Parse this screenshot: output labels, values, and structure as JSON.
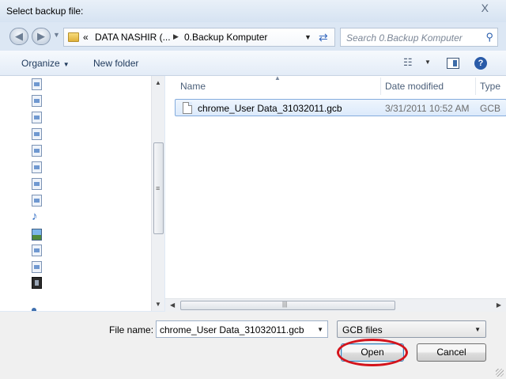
{
  "window": {
    "title": "Select backup file:",
    "close_glyph": "X"
  },
  "address": {
    "more_glyph": "«",
    "crumbs": [
      "DATA NASHIR (...",
      "0.Backup Komputer"
    ],
    "search_placeholder": "Search 0.Backup Komputer"
  },
  "toolbar": {
    "organize": "Organize",
    "new_folder": "New folder"
  },
  "nav_icons": [
    "document-icon",
    "document-icon",
    "document-icon",
    "document-icon",
    "document-icon",
    "document-icon",
    "document-icon",
    "document-icon",
    "music-icon",
    "pictures-icon",
    "document-icon",
    "document-icon",
    "video-icon",
    "network-icon"
  ],
  "columns": {
    "name": "Name",
    "date": "Date modified",
    "type": "Type"
  },
  "files": [
    {
      "name": "chrome_User Data_31032011.gcb",
      "date": "3/31/2011 10:52 AM",
      "type": "GCB"
    }
  ],
  "footer": {
    "file_name_label": "File name:",
    "file_name_value": "chrome_User Data_31032011.gcb",
    "file_type": "GCB files",
    "open": "Open",
    "cancel": "Cancel"
  },
  "colors": {
    "highlight_ring": "#d4141c",
    "selection": "#dceafb",
    "accent": "#2a5ba8"
  }
}
